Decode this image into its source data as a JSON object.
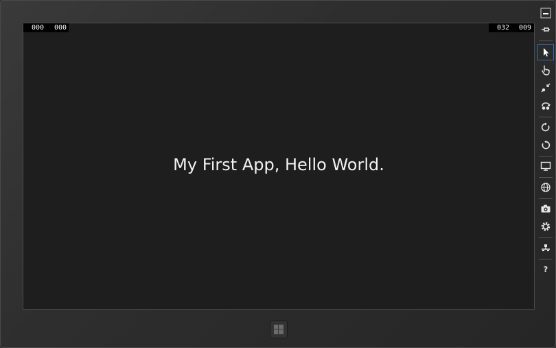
{
  "counters": {
    "left_a": "000",
    "left_b": "000",
    "right_a": "032",
    "right_b": "009"
  },
  "app": {
    "message": "My First App, Hello World."
  },
  "toolbar": {
    "items": [
      {
        "icon": "minimize-icon"
      },
      {
        "icon": "pin-icon"
      },
      {
        "icon": "mouse-mode-icon",
        "selected": true
      },
      {
        "icon": "touch-mode-icon"
      },
      {
        "icon": "pinch-zoom-icon"
      },
      {
        "icon": "rotation-touch-icon"
      },
      {
        "icon": "rotate-clockwise-icon"
      },
      {
        "icon": "rotate-counterclockwise-icon"
      },
      {
        "icon": "resolution-icon"
      },
      {
        "icon": "location-icon"
      },
      {
        "icon": "screenshot-icon"
      },
      {
        "icon": "settings-icon"
      },
      {
        "icon": "network-icon"
      },
      {
        "icon": "help-icon"
      }
    ],
    "help_glyph": "?"
  },
  "colors": {
    "background": "#1e1e1e",
    "text": "#f2f2f2",
    "selected_border": "#2f6fb7"
  }
}
